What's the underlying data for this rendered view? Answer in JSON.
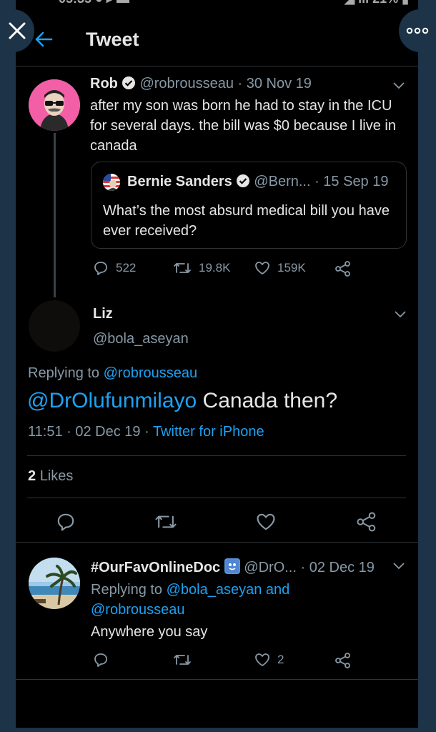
{
  "header": {
    "title": "Tweet"
  },
  "main_tweet": {
    "name": "Rob",
    "handle": "@robrousseau",
    "date": "· 30 Nov 19",
    "text": "after my son was born he had to stay in the ICU for several days. the bill was $0 because I live in canada",
    "quote": {
      "name": "Bernie Sanders",
      "handle": "@Bern...",
      "date": "· 15 Sep 19",
      "text": "What’s the most absurd medical bill you have ever received?"
    },
    "stats": {
      "replies": "522",
      "retweets": "19.8K",
      "likes": "159K"
    }
  },
  "focus_tweet": {
    "name": "Liz",
    "handle": "@bola_aseyan",
    "replying_prefix": "Replying to",
    "replying_to": "@robrousseau",
    "mention": "@DrOlufunmilayo",
    "text": "Canada then?",
    "time": "11:51 · 02 Dec 19 ·",
    "source": "Twitter for iPhone",
    "likes_count": "2",
    "likes_label": "Likes"
  },
  "reply_tweet": {
    "name": "#OurFavOnlineDoc",
    "handle": "@DrO...",
    "date": "· 02 Dec 19",
    "replying_prefix": "Replying to",
    "replying_to_1": "@bola_aseyan",
    "replying_and": "and",
    "replying_to_2": "@robrousseau",
    "text": "Anywhere you say",
    "likes": "2"
  },
  "colors": {
    "accent": "#1da1f2",
    "background": "#000000",
    "frame": "#1c3348",
    "muted": "#8899a6"
  },
  "icons": [
    "close-icon",
    "more-icon",
    "back-arrow-icon",
    "verified-icon",
    "reply-icon",
    "retweet-icon",
    "like-icon",
    "share-icon",
    "chevron-down-icon"
  ]
}
